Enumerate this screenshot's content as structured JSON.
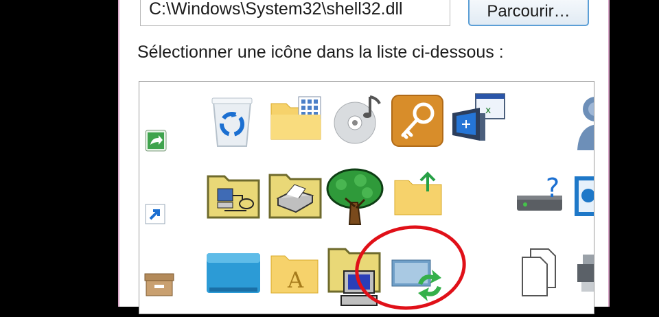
{
  "dialog": {
    "path_value": "C:\\Windows\\System32\\shell32.dll",
    "browse_label": "Parcourir…",
    "select_label": "Sélectionner une icône dans la liste ci-dessous :"
  },
  "icons": [
    "shortcut-overlay-icon",
    "recycle-bin-icon",
    "folder-grid-icon",
    "cd-audio-icon",
    "key-icon",
    "computer-window-icon",
    "user-icon",
    "shortcut-arrow-icon",
    "network-folder-icon",
    "printer-folder-icon",
    "tree-icon",
    "folder-up-arrow-icon",
    "drive-help-icon",
    "monitor-icon",
    "archive-box-icon",
    "blue-drive-icon",
    "font-folder-icon",
    "folder-computer-icon",
    "sync-monitor-icon",
    "documents-icon",
    "printer-icon"
  ],
  "colors": {
    "highlight": "#e01018",
    "dialog_border": "#d9a7c9",
    "button_border": "#5c9fd6"
  }
}
